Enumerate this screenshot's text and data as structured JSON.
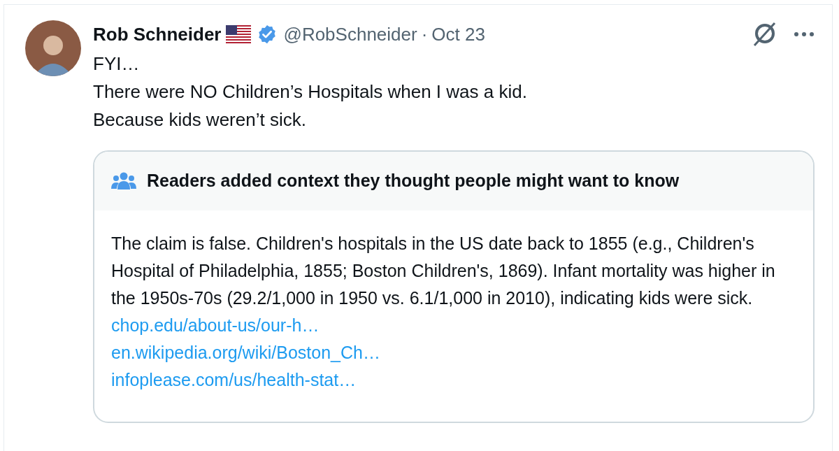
{
  "post": {
    "author": {
      "name": "Rob Schneider",
      "verified": true,
      "handle": "@RobSchneider",
      "separator": "·",
      "date": "Oct 23"
    },
    "lines": [
      "FYI…",
      "There were NO Children’s Hospitals when I was a kid.",
      "Because kids weren’t sick."
    ],
    "community_note": {
      "heading": "Readers added context they thought people might want to know",
      "body": "The claim is false. Children's hospitals in the US date back to 1855 (e.g., Children's Hospital of Philadelphia, 1855; Boston Children's, 1869). Infant mortality was higher in the 1950s-70s (29.2/1,000 in 1950 vs. 6.1/1,000 in 2010), indicating kids were sick.",
      "links": [
        "chop.edu/about-us/our-h…",
        "en.wikipedia.org/wiki/Boston_Ch…",
        "infoplease.com/us/health-stat…"
      ]
    }
  }
}
